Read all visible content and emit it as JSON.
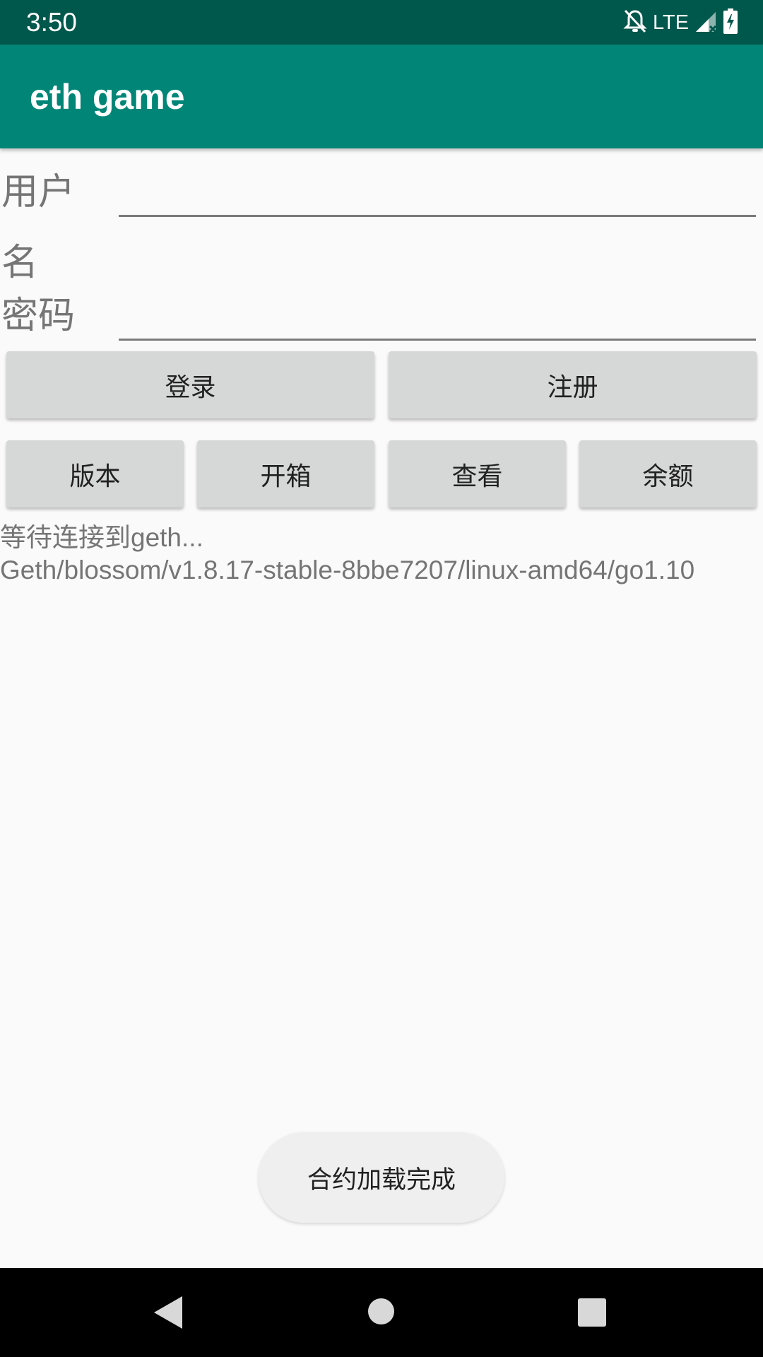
{
  "status_bar": {
    "time": "3:50",
    "network": "LTE",
    "icons": [
      "bell-off-icon",
      "signal-icon",
      "battery-charging-icon"
    ]
  },
  "app_bar": {
    "title": "eth game"
  },
  "form": {
    "username_label": "用户名",
    "username_value": "",
    "password_label": "密码",
    "password_value": ""
  },
  "buttons": {
    "login": "登录",
    "register": "注册",
    "version": "版本",
    "open_box": "开箱",
    "view": "查看",
    "balance": "余额"
  },
  "log": {
    "line1": "等待连接到geth...",
    "line2": "Geth/blossom/v1.8.17-stable-8bbe7207/linux-amd64/go1.10"
  },
  "toast": {
    "message": "合约加载完成"
  },
  "nav_bar": {
    "icons": [
      "back-icon",
      "home-icon",
      "recents-icon"
    ]
  },
  "colors": {
    "status_bar": "#00574b",
    "app_bar": "#008577",
    "background": "#fafafa",
    "button": "#d6d7d7",
    "toast": "#efefef"
  }
}
